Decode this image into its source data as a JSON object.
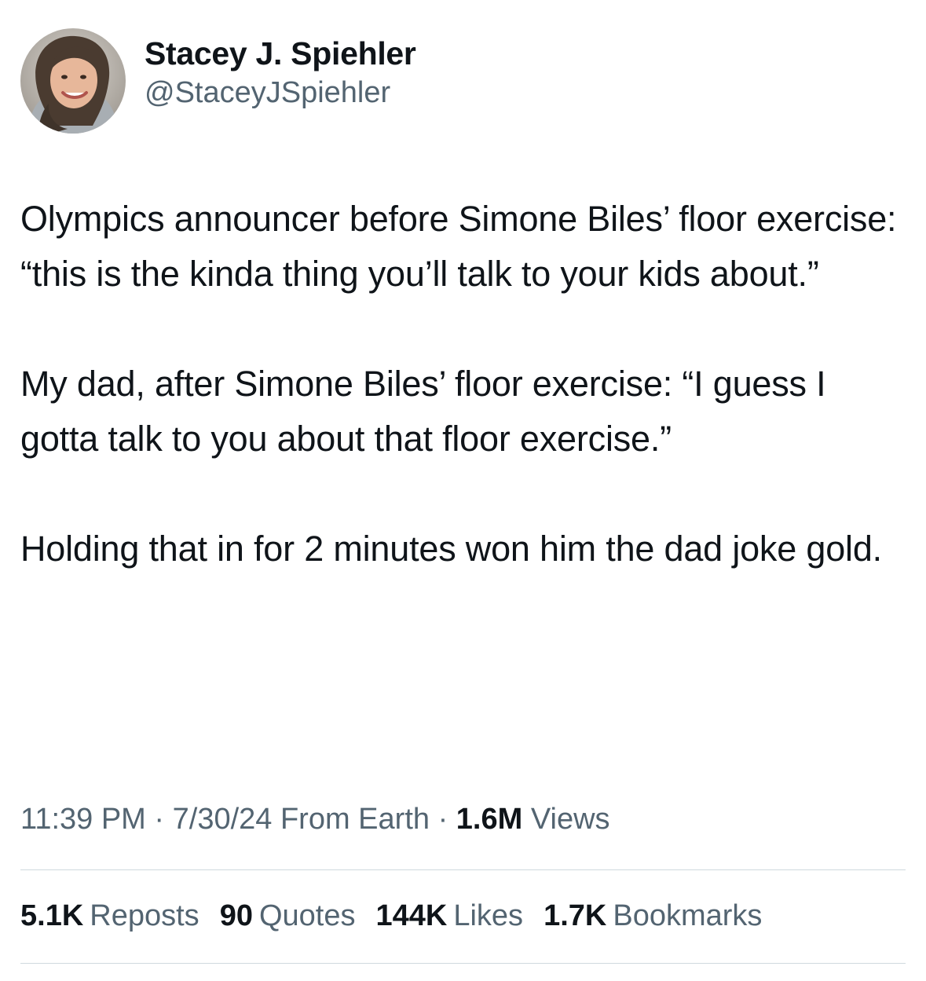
{
  "author": {
    "display_name": "Stacey J. Spiehler",
    "handle": "@StaceyJSpiehler",
    "avatar_icon": "profile-photo"
  },
  "tweet": {
    "paragraphs": [
      "Olympics announcer before Simone Biles’ floor exercise: “this is the kinda thing you’ll talk to your kids about.”",
      "My dad, after Simone Biles’ floor exercise: “I guess I gotta talk to you about that floor exercise.”",
      "Holding that in for 2 minutes won him the dad joke gold."
    ]
  },
  "meta": {
    "time": "11:39 PM",
    "separator": "·",
    "date_source": "7/30/24 From Earth",
    "views_count": "1.6M",
    "views_label": "Views"
  },
  "stats": [
    {
      "count": "5.1K",
      "label": "Reposts"
    },
    {
      "count": "90",
      "label": "Quotes"
    },
    {
      "count": "144K",
      "label": "Likes"
    },
    {
      "count": "1.7K",
      "label": "Bookmarks"
    }
  ],
  "colors": {
    "text_primary": "#0f1419",
    "text_secondary": "#536471",
    "divider": "#cfd9de",
    "background": "#ffffff"
  }
}
